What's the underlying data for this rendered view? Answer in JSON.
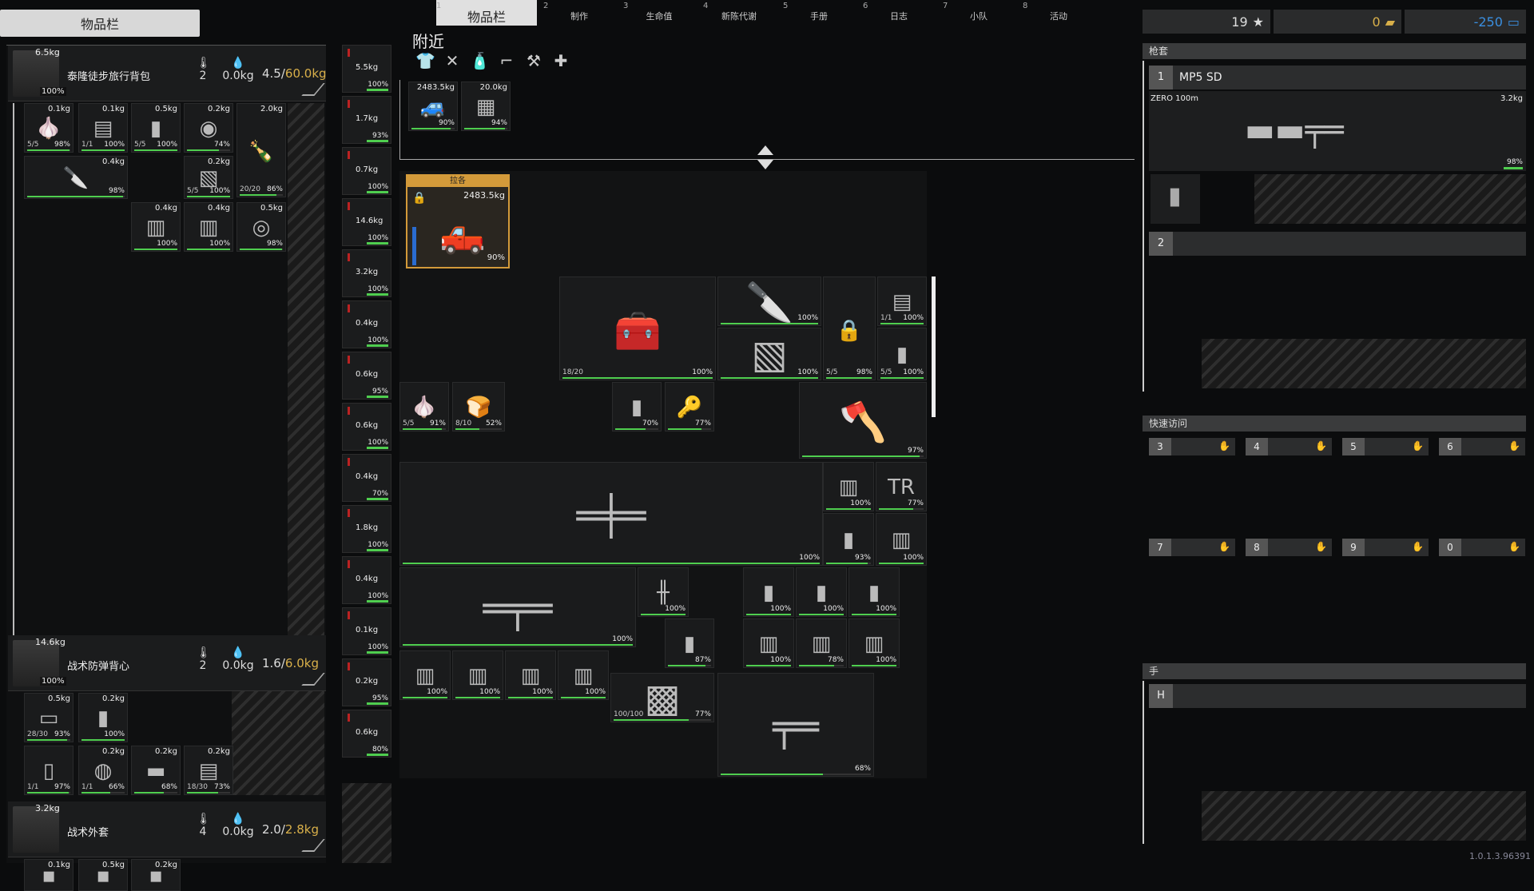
{
  "left_tab": "物品栏",
  "tabs": [
    {
      "num": "1",
      "label": "物品栏",
      "active": true
    },
    {
      "num": "2",
      "label": "制作"
    },
    {
      "num": "3",
      "label": "生命值"
    },
    {
      "num": "4",
      "label": "新陈代谢"
    },
    {
      "num": "5",
      "label": "手册"
    },
    {
      "num": "6",
      "label": "日志"
    },
    {
      "num": "7",
      "label": "小队"
    },
    {
      "num": "8",
      "label": "活动"
    }
  ],
  "containers": [
    {
      "weight": "6.5kg",
      "cond": "100%",
      "name": "泰隆徒步旅行背包",
      "temp": "2",
      "water": "0.0kg",
      "cap_used": "4.5/",
      "cap_max": "60.0kg"
    },
    {
      "weight": "14.6kg",
      "cond": "100%",
      "name": "战术防弹背心",
      "temp": "2",
      "water": "0.0kg",
      "cap_used": "1.6/",
      "cap_max": "6.0kg"
    },
    {
      "weight": "3.2kg",
      "cond": "",
      "name": "战术外套",
      "temp": "4",
      "water": "0.0kg",
      "cap_used": "2.0/",
      "cap_max": "2.8kg"
    }
  ],
  "backpack_items": [
    {
      "w": "0.1kg",
      "cnt": "5/5",
      "pct": "98%",
      "fill": 0.98
    },
    {
      "w": "0.1kg",
      "cnt": "1/1",
      "pct": "100%",
      "fill": 1
    },
    {
      "w": "0.5kg",
      "cnt": "5/5",
      "pct": "100%",
      "fill": 1
    },
    {
      "w": "0.2kg",
      "cnt": "",
      "pct": "74%",
      "fill": 0.74
    },
    {
      "w": "2.0kg",
      "cnt": "20/20",
      "pct": "86%",
      "fill": 0.86
    },
    {
      "w": "0.4kg",
      "cnt": "",
      "pct": "98%",
      "fill": 0.98
    },
    {
      "w": "0.2kg",
      "cnt": "5/5",
      "pct": "100%",
      "fill": 1
    },
    {
      "w": "0.4kg",
      "cnt": "",
      "pct": "100%",
      "fill": 1
    },
    {
      "w": "0.4kg",
      "cnt": "",
      "pct": "100%",
      "fill": 1
    },
    {
      "w": "0.5kg",
      "cnt": "",
      "pct": "98%",
      "fill": 0.98
    }
  ],
  "vest_items": [
    {
      "w": "0.5kg",
      "cnt": "28/30",
      "pct": "93%",
      "fill": 0.93
    },
    {
      "w": "0.2kg",
      "cnt": "",
      "pct": "100%",
      "fill": 1
    },
    {
      "w": "",
      "cnt": "1/1",
      "pct": "97%",
      "fill": 0.97
    },
    {
      "w": "0.2kg",
      "cnt": "1/1",
      "pct": "66%",
      "fill": 0.66
    },
    {
      "w": "0.2kg",
      "cnt": "",
      "pct": "68%",
      "fill": 0.68
    },
    {
      "w": "0.2kg",
      "cnt": "18/30",
      "pct": "73%",
      "fill": 0.73
    }
  ],
  "jacket_items": [
    {
      "w": "0.1kg"
    },
    {
      "w": "0.5kg"
    },
    {
      "w": "0.2kg"
    }
  ],
  "equip_slots": [
    {
      "w": "5.5kg",
      "pct": "100%"
    },
    {
      "w": "1.7kg",
      "pct": "93%"
    },
    {
      "w": "0.7kg",
      "pct": "100%"
    },
    {
      "w": "14.6kg",
      "pct": "100%"
    },
    {
      "w": "3.2kg",
      "pct": "100%"
    },
    {
      "w": "0.4kg",
      "pct": "100%"
    },
    {
      "w": "0.6kg",
      "pct": "95%"
    },
    {
      "w": "0.6kg",
      "pct": "100%"
    },
    {
      "w": "0.4kg",
      "pct": "70%"
    },
    {
      "w": "1.8kg",
      "pct": "100%"
    },
    {
      "w": "0.4kg",
      "pct": "100%"
    },
    {
      "w": "0.1kg",
      "pct": "100%"
    },
    {
      "w": "0.2kg",
      "pct": "95%"
    },
    {
      "w": "0.6kg",
      "pct": "80%"
    }
  ],
  "nearby": {
    "title": "附近",
    "strip": [
      {
        "w": "2483.5kg",
        "pct": "90%"
      },
      {
        "w": "20.0kg",
        "pct": "94%"
      }
    ],
    "selected": {
      "label": "拉各",
      "w": "2483.5kg",
      "pct": "90%"
    },
    "loot": [
      {
        "name": "vehicle-repair-kit",
        "cnt": "18/20",
        "pct": "100%"
      },
      {
        "name": "knife",
        "pct": "100%"
      },
      {
        "name": "lock",
        "pct": "98%",
        "cnt": "5/5"
      },
      {
        "name": "bandage",
        "pct": "100%",
        "cnt": "1/1"
      },
      {
        "name": "rag",
        "pct": "100%"
      },
      {
        "name": "water-bottle",
        "cnt": "5/5",
        "pct": "100%"
      },
      {
        "name": "garlic",
        "cnt": "5/5",
        "pct": "91%"
      },
      {
        "name": "bread",
        "cnt": "8/10",
        "pct": "52%"
      },
      {
        "name": "magazine",
        "pct": "70%"
      },
      {
        "name": "lockpick",
        "pct": "77%"
      },
      {
        "name": "axe",
        "pct": "97%"
      },
      {
        "name": "flamethrower",
        "pct": "100%"
      },
      {
        "name": "ammo-box-1",
        "pct": "100%"
      },
      {
        "name": "ammo-tr",
        "pct": "77%"
      },
      {
        "name": "mag-2",
        "pct": "93%"
      },
      {
        "name": "ammo-box-2",
        "pct": "100%"
      },
      {
        "name": "mp5",
        "pct": "100%"
      },
      {
        "name": "rail",
        "pct": "100%"
      },
      {
        "name": "mag-3",
        "pct": "87%"
      },
      {
        "name": "mag-a",
        "pct": "100%"
      },
      {
        "name": "mag-b",
        "pct": "100%"
      },
      {
        "name": "mag-c",
        "pct": "100%"
      },
      {
        "name": "ammo-c1",
        "pct": "100%"
      },
      {
        "name": "ammo-c2",
        "pct": "78%"
      },
      {
        "name": "ammo-c3",
        "pct": "100%"
      },
      {
        "name": "box-1",
        "pct": "100%"
      },
      {
        "name": "box-2",
        "pct": "100%"
      },
      {
        "name": "box-3",
        "pct": "100%"
      },
      {
        "name": "box-4",
        "pct": "100%"
      },
      {
        "name": "kit-case",
        "cnt": "100/100",
        "pct": "77%"
      },
      {
        "name": "ump",
        "pct": "68%"
      }
    ]
  },
  "stats": {
    "fame": "19",
    "gold": "0",
    "money": "-250"
  },
  "holster": {
    "title": "枪套",
    "slot1": {
      "idx": "1",
      "name": "MP5 SD",
      "zero": "ZERO 100m",
      "w": "3.2kg",
      "pct": "98%"
    },
    "slot2": {
      "idx": "2"
    }
  },
  "quick_access": {
    "title": "快速访问",
    "slots": [
      "3",
      "4",
      "5",
      "6",
      "7",
      "8",
      "9",
      "0"
    ]
  },
  "hand": {
    "title": "手",
    "idx": "H"
  },
  "version": "1.0.1.3.96391",
  "colors": {
    "accent": "#d39a3a",
    "health": "#4fce4f",
    "gold": "#d9b04a",
    "money": "#3a8fe0"
  }
}
